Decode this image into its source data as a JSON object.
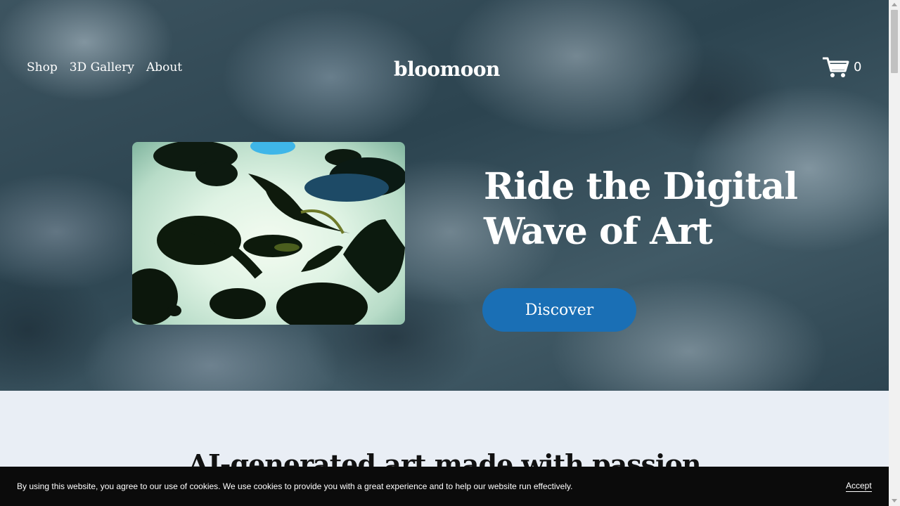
{
  "header": {
    "nav": [
      {
        "label": "Shop"
      },
      {
        "label": "3D Gallery"
      },
      {
        "label": "About"
      }
    ],
    "logo": "bloomoon",
    "cart": {
      "count": "0",
      "icon": "shopping-cart-icon"
    }
  },
  "hero": {
    "title": "Ride the Digital Wave of Art",
    "button_label": "Discover",
    "image": "ai-generated-fish-artwork"
  },
  "section": {
    "heading": "AI-generated art made with passion"
  },
  "cookie_banner": {
    "text": "By using this website, you agree to our use of cookies. We use cookies to provide you with a great experience and to help our website run effectively.",
    "accept_label": "Accept"
  },
  "colors": {
    "button": "#1a6fb5",
    "cookie_bg": "#0b0b0b",
    "section_bg": "#e9eef5"
  }
}
